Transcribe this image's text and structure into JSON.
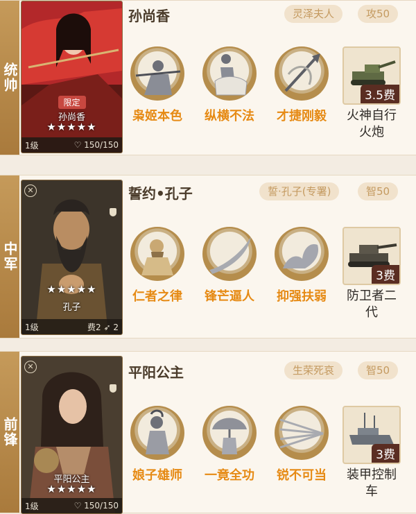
{
  "generals": [
    {
      "role": "统帅",
      "name": "孙尚香",
      "title_tag": "灵泽夫人",
      "stat_tag": "攻50",
      "card": {
        "limited": "限定",
        "name": "孙尚香",
        "stars": "★★★★★",
        "level": "1级",
        "hp": "150/150"
      },
      "skills": [
        {
          "icon": "archer-icon",
          "label": "枭姬本色"
        },
        {
          "icon": "horse-rider-icon",
          "label": "纵横不法"
        },
        {
          "icon": "spear-icon",
          "label": "才捷刚毅"
        }
      ],
      "equipment": {
        "icon": "tank-icon",
        "cost": "3.5费",
        "label1": "火神自行",
        "label2": "火炮"
      }
    },
    {
      "role": "中军",
      "name": "誓约•孔子",
      "title_tag": "誓·孔子(专署)",
      "stat_tag": "智50",
      "card": {
        "name": "孔子",
        "stars": "★★★★★",
        "level": "1级",
        "cost": "费2",
        "feather_count": "2"
      },
      "skills": [
        {
          "icon": "sage-icon",
          "label": "仁者之律"
        },
        {
          "icon": "blade-icon",
          "label": "锋芒逼人"
        },
        {
          "icon": "arm-muscle-icon",
          "label": "抑强扶弱"
        }
      ],
      "equipment": {
        "icon": "tank-icon",
        "cost": "3费",
        "label1": "防卫者二",
        "label2": "代"
      }
    },
    {
      "role": "前锋",
      "name": "平阳公主",
      "title_tag": "生荣死哀",
      "stat_tag": "智50",
      "card": {
        "name": "平阳公主",
        "stars": "★★★★★",
        "level": "1级",
        "hp": "150/150"
      },
      "skills": [
        {
          "icon": "warrior-woman-icon",
          "label": "娘子雄师"
        },
        {
          "icon": "umbrella-figure-icon",
          "label": "一竟全功"
        },
        {
          "icon": "arrows-icon",
          "label": "锐不可当"
        }
      ],
      "equipment": {
        "icon": "armored-vehicle-icon",
        "cost": "3费",
        "label1": "装甲控制",
        "label2": "车"
      }
    }
  ]
}
